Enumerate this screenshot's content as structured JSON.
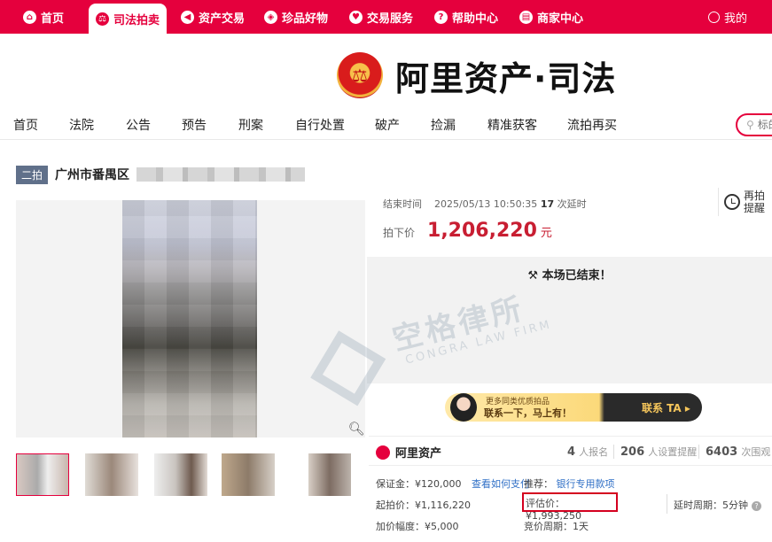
{
  "topnav": {
    "items": [
      {
        "label": "首页",
        "icon": "home-icon"
      },
      {
        "label": "司法拍卖",
        "icon": "court-emblem-icon",
        "active": true
      },
      {
        "label": "资产交易",
        "icon": "asset-icon"
      },
      {
        "label": "珍品好物",
        "icon": "treasure-icon"
      },
      {
        "label": "交易服务",
        "icon": "heart-icon"
      },
      {
        "label": "帮助中心",
        "icon": "help-icon"
      },
      {
        "label": "商家中心",
        "icon": "merchant-icon"
      }
    ],
    "user_label": "我的"
  },
  "logo": {
    "text": "阿里资产·司法"
  },
  "subnav": {
    "items": [
      "首页",
      "法院",
      "公告",
      "预告",
      "刑案",
      "自行处置",
      "破产",
      "捡漏",
      "精准获客",
      "流拍再买"
    ],
    "search_placeholder": "标的"
  },
  "listing": {
    "badge": "二拍",
    "title": "广州市番禺区"
  },
  "auction": {
    "end_label": "结束时间",
    "end_time": "2025/05/13 10:50:35",
    "delay_count": "17",
    "delay_label": "次延时",
    "remind_label_1": "再拍",
    "remind_label_2": "提醒",
    "price_label": "拍下价",
    "price": "1,206,220",
    "price_unit": "元",
    "ended_text": "本场已结束！"
  },
  "banner": {
    "line1": "更多同类优质拍品",
    "line2": "联系一下，马上有！",
    "cta": "联系 TA ▸"
  },
  "stats": {
    "brand": "阿里资产",
    "signups": "4",
    "signups_label": "人报名",
    "reminders": "206",
    "reminders_label": "人设置提醒",
    "views": "6403",
    "views_label": "次围观"
  },
  "details": {
    "deposit": "保证金：¥120,000",
    "deposit_link": "查看如何支付",
    "recommend_label": "推荐：",
    "recommend_link": "银行专用款项",
    "start_price": "起拍价：¥1,116,220",
    "eval_price": "评估价：¥1,993,250",
    "delay_period": "延时周期：5分钟",
    "increment": "加价幅度：¥5,000",
    "bid_period": "竞价周期：1天"
  },
  "watermark": {
    "cn": "空格律所",
    "en": "CONGRA LAW FIRM"
  },
  "colors": {
    "brand_red": "#e5003d",
    "price_red": "#c81e32",
    "link_blue": "#2f6fc6",
    "badge_gray": "#60708a"
  }
}
